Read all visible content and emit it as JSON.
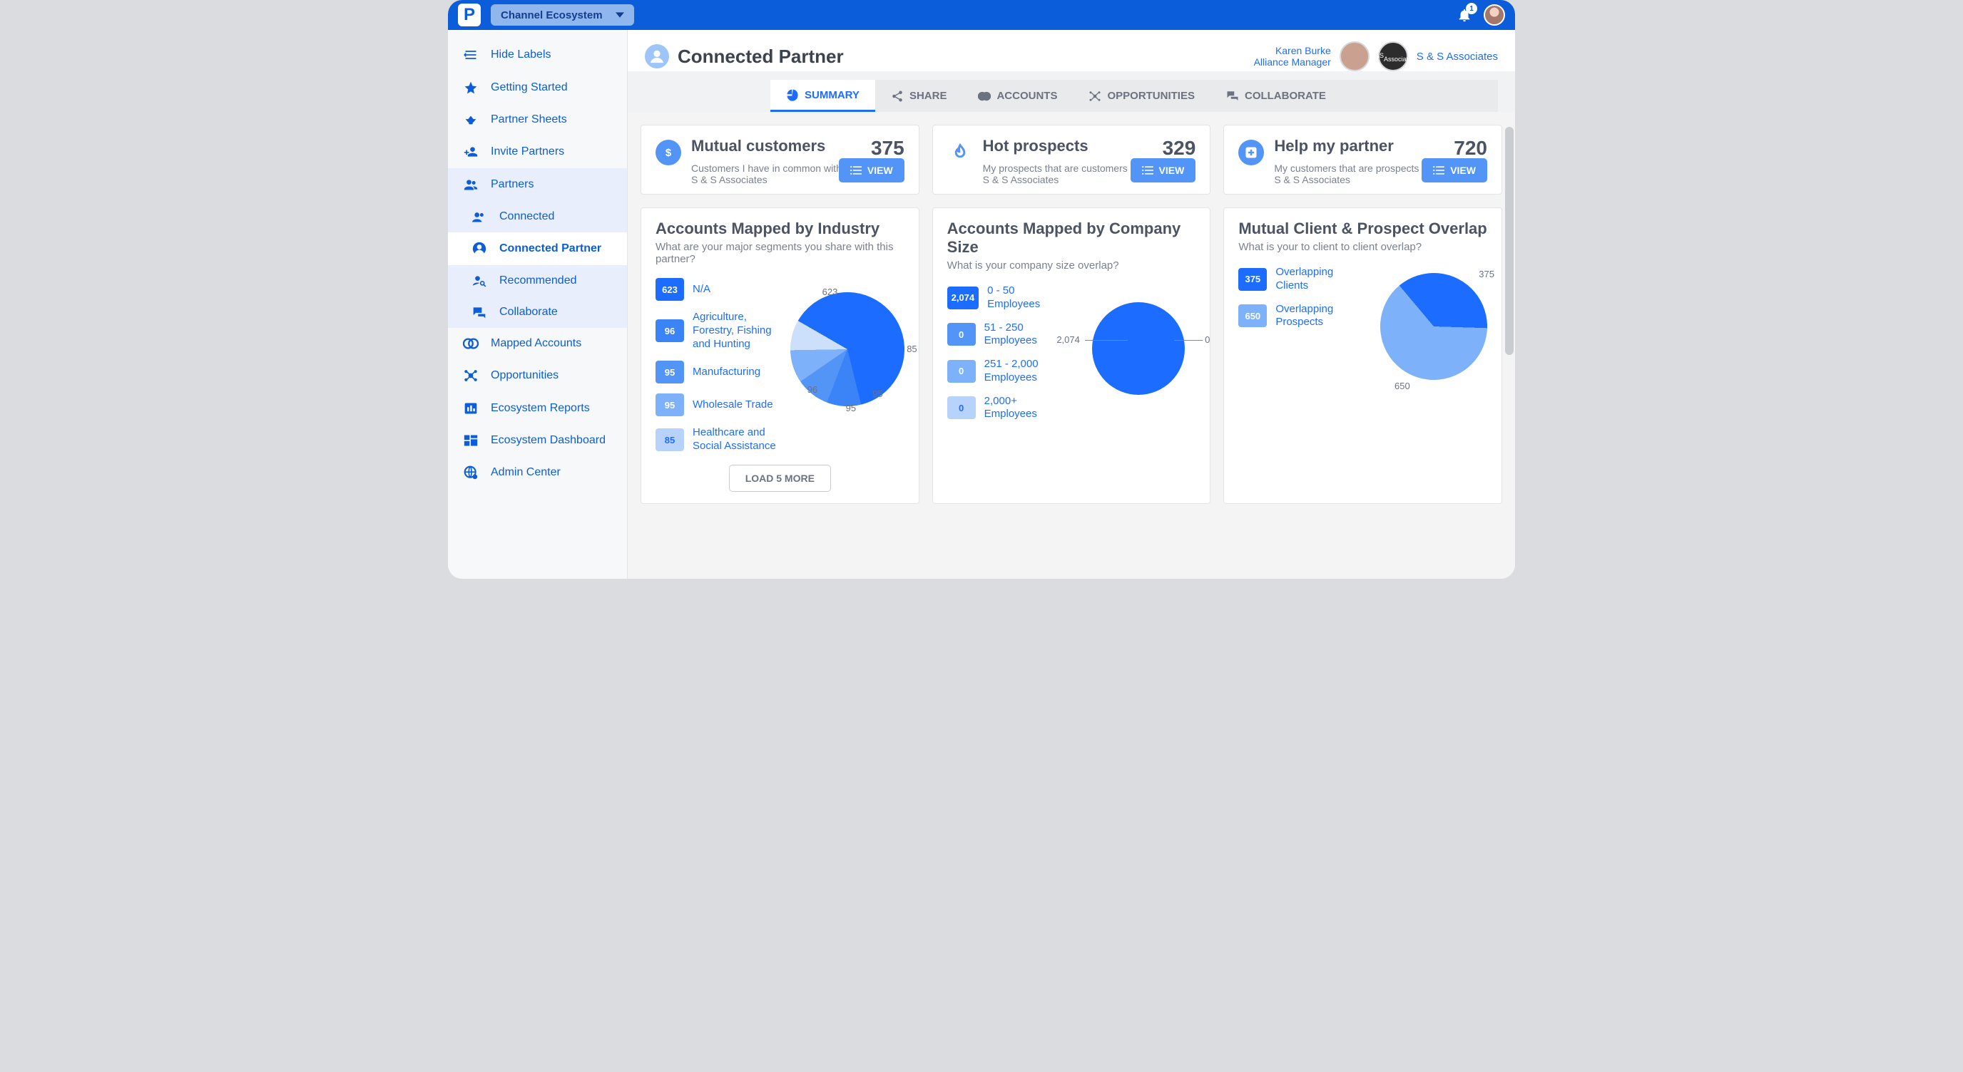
{
  "top": {
    "workspace": "Channel Ecosystem",
    "notification_count": "1"
  },
  "user": {
    "name": "Karen Burke",
    "role": "Alliance Manager",
    "partner_company": "S & S Associates",
    "partner_badge": "S&S"
  },
  "sidebar": {
    "hide_labels": "Hide Labels",
    "items": [
      {
        "label": "Getting Started"
      },
      {
        "label": "Partner Sheets"
      },
      {
        "label": "Invite Partners"
      },
      {
        "label": "Partners"
      },
      {
        "label": "Mapped Accounts"
      },
      {
        "label": "Opportunities"
      },
      {
        "label": "Ecosystem Reports"
      },
      {
        "label": "Ecosystem Dashboard"
      },
      {
        "label": "Admin Center"
      }
    ],
    "partners_sub": [
      {
        "label": "Connected"
      },
      {
        "label": "Connected Partner"
      },
      {
        "label": "Recommended"
      },
      {
        "label": "Collaborate"
      }
    ]
  },
  "header": {
    "title": "Connected Partner"
  },
  "tabs": [
    {
      "label": "SUMMARY"
    },
    {
      "label": "SHARE"
    },
    {
      "label": "ACCOUNTS"
    },
    {
      "label": "OPPORTUNITIES"
    },
    {
      "label": "COLLABORATE"
    }
  ],
  "kpis": [
    {
      "title": "Mutual customers",
      "value": "375",
      "subtitle": "Customers I have in common with S & S Associates",
      "button": "VIEW"
    },
    {
      "title": "Hot prospects",
      "value": "329",
      "subtitle": "My prospects that are customers of S & S Associates",
      "button": "VIEW"
    },
    {
      "title": "Help my partner",
      "value": "720",
      "subtitle": "My customers that are prospects of S & S Associates",
      "button": "VIEW"
    }
  ],
  "charts": {
    "industry": {
      "title": "Accounts Mapped by Industry",
      "subtitle": "What are your major segments you share with this partner?",
      "load_more": "LOAD 5 MORE"
    },
    "size": {
      "title": "Accounts Mapped by Company Size",
      "subtitle": "What is your company size overlap?"
    },
    "overlap": {
      "title": "Mutual Client & Prospect Overlap",
      "subtitle": "What is your to client to client overlap?"
    }
  },
  "chart_data": [
    {
      "id": "industry",
      "type": "pie",
      "title": "Accounts Mapped by Industry",
      "series": [
        {
          "name": "N/A",
          "value": 623,
          "color": "#1c6dff"
        },
        {
          "name": "Agriculture, Forestry, Fishing and Hunting",
          "value": 96,
          "color": "#3b84f7"
        },
        {
          "name": "Manufacturing",
          "value": 95,
          "color": "#5394f7"
        },
        {
          "name": "Wholesale Trade",
          "value": 95,
          "color": "#7db1f9"
        },
        {
          "name": "Healthcare and Social Assistance",
          "value": 85,
          "color": "#b7d3fb"
        }
      ]
    },
    {
      "id": "company_size",
      "type": "pie",
      "title": "Accounts Mapped by Company Size",
      "series": [
        {
          "name": "0 - 50 Employees",
          "value": 2074,
          "color": "#1c6dff"
        },
        {
          "name": "51 - 250 Employees",
          "value": 0,
          "color": "#5394f7"
        },
        {
          "name": "251 - 2,000 Employees",
          "value": 0,
          "color": "#7db1f9"
        },
        {
          "name": "2,000+ Employees",
          "value": 0,
          "color": "#b7d3fb"
        }
      ]
    },
    {
      "id": "overlap",
      "type": "pie",
      "title": "Mutual Client & Prospect Overlap",
      "series": [
        {
          "name": "Overlapping Clients",
          "value": 375,
          "color": "#1c6dff"
        },
        {
          "name": "Overlapping Prospects",
          "value": 650,
          "color": "#7db1f9"
        }
      ]
    }
  ]
}
